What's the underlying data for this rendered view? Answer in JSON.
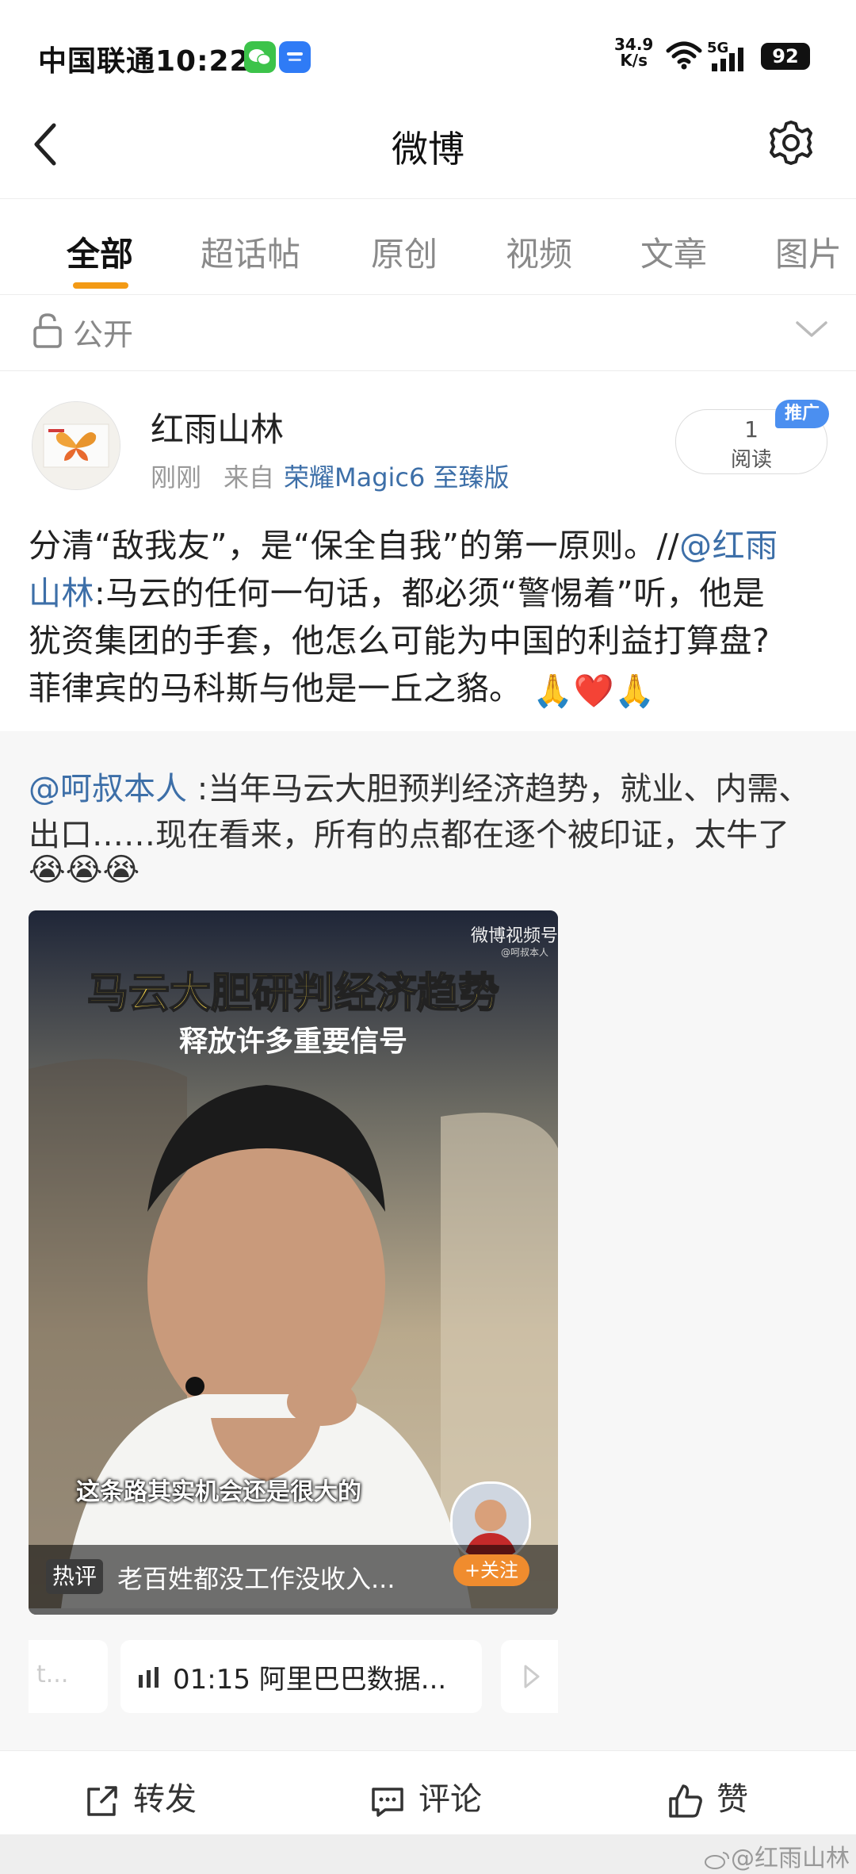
{
  "status_bar": {
    "carrier_time": "中国联通10:22",
    "net_speed_value": "34.9",
    "net_speed_unit": "K/s",
    "signal": "5G",
    "battery": "92"
  },
  "header": {
    "title": "微博"
  },
  "tabs": [
    {
      "label": "全部"
    },
    {
      "label": "超话帖"
    },
    {
      "label": "原创"
    },
    {
      "label": "视频"
    },
    {
      "label": "文章"
    },
    {
      "label": "图片"
    }
  ],
  "visibility": {
    "label": "公开"
  },
  "post": {
    "author": "红雨山林",
    "time": "刚刚",
    "source_prefix": "来自",
    "source": "荣耀Magic6 至臻版",
    "read_count": "1",
    "read_label": "阅读",
    "promo_tag": "推广",
    "lines": [
      {
        "text": "分清“敌我友”，是“保全自我”的第一原则。//",
        "link": "@红雨"
      },
      {
        "link": "山林",
        "text": ":马云的任何一句话，都必须“警惕着”听，他是"
      },
      {
        "text": "犹资集团的手套，他怎么可能为中国的利益打算盘?"
      },
      {
        "text": "菲律宾的马科斯与他是一丘之貉。"
      }
    ],
    "end_emojis": [
      "🙏",
      "❤️",
      "🙏"
    ]
  },
  "retweet": {
    "mention": "@呵叔本人",
    "line1": " :当年马云大胆预判经济趋势，就业、内需、",
    "line2": "出口……现在看来，所有的点都在逐个被印证，太牛了",
    "emojis": [
      "😭",
      "😭",
      "😭"
    ],
    "video": {
      "channel": "微博视频号",
      "channel_sub": "@呵叔本人",
      "title": "马云大胆研判经济趋势",
      "subtitle": "释放许多重要信号",
      "caption": "这条路其实机会还是很大的",
      "hot_tag": "热评",
      "hot_comment": "老百姓都没工作没收入...",
      "follow_label": "+关注"
    },
    "audio": {
      "prev_text": "t...",
      "duration": "01:15",
      "title": "阿里巴巴数据..."
    }
  },
  "actions": {
    "repost": "转发",
    "comment": "评论",
    "like": "赞"
  },
  "watermark": "@红雨山林"
}
